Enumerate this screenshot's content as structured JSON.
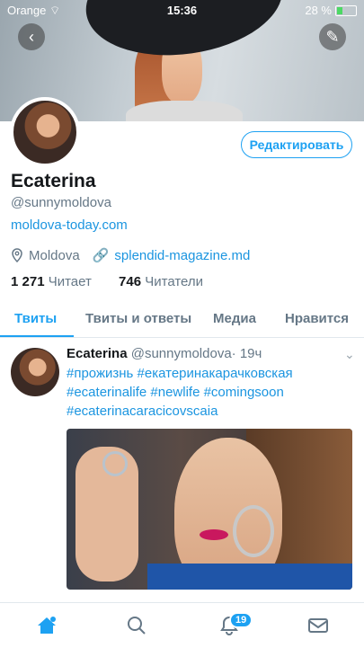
{
  "status": {
    "carrier": "Orange",
    "time": "15:36",
    "battery": "28 %"
  },
  "profile": {
    "name": "Ecaterina",
    "handle": "@sunnymoldova",
    "website": "moldova-today.com",
    "location": "Moldova",
    "link": "splendid-magazine.md",
    "following_count": "1 271",
    "following_label": "Читает",
    "followers_count": "746",
    "followers_label": "Читатели",
    "edit_label": "Редактировать"
  },
  "tabs": [
    "Твиты",
    "Твиты и ответы",
    "Медиа",
    "Нравится"
  ],
  "tweet": {
    "name": "Ecaterina",
    "handle": "@sunnymoldova",
    "time": "· 19ч",
    "text": "#прожизнь #екатеринакарачковская #ecaterinalife #newlife #comingsoon #ecaterinacaracicovscaia"
  },
  "nav": {
    "notifications_badge": "19"
  },
  "colors": {
    "accent": "#1da1f2"
  }
}
